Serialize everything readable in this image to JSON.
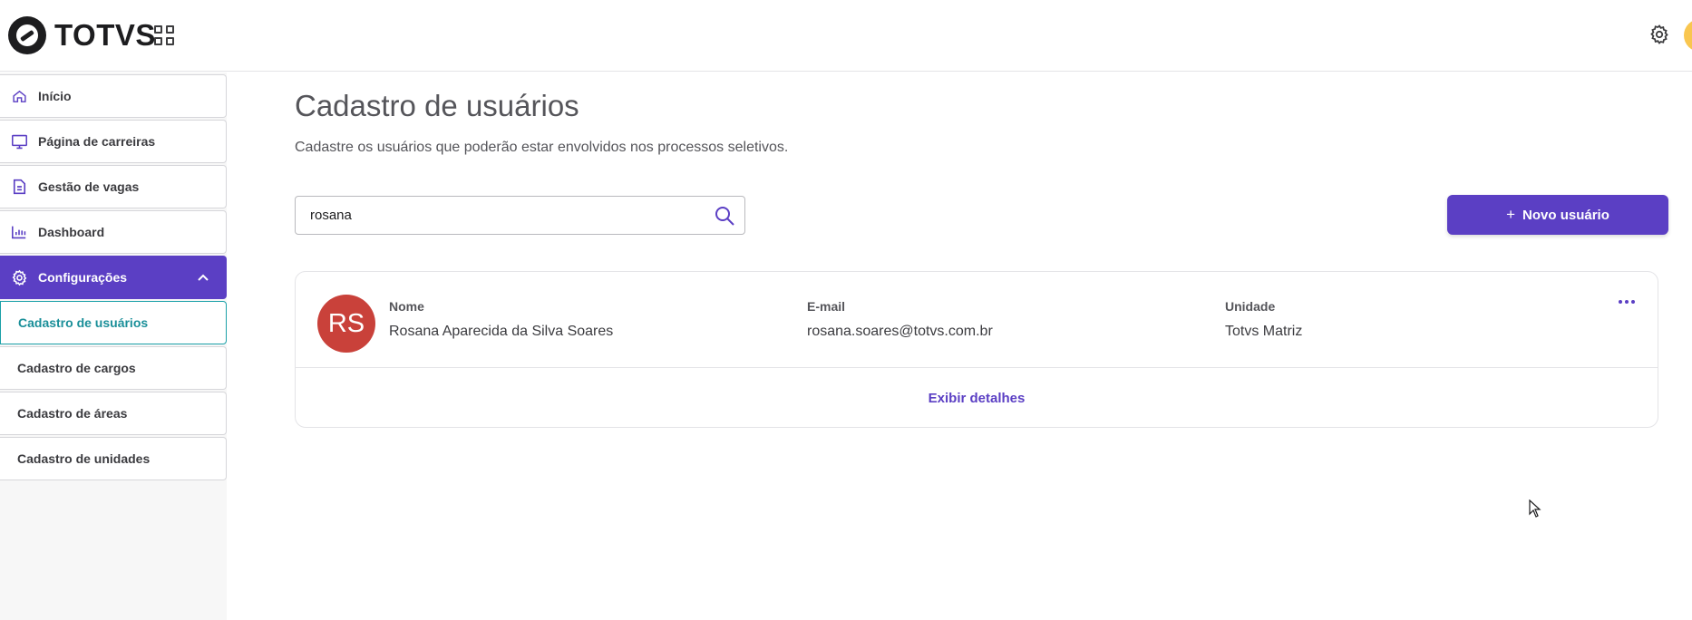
{
  "header": {
    "logo_text": "TOTVS",
    "apps_icon": "grid-icon",
    "settings_icon": "gear-icon",
    "avatar_color": "#f9c64f"
  },
  "sidebar": {
    "items": [
      {
        "label": "Início",
        "icon": "home-icon"
      },
      {
        "label": "Página de carreiras",
        "icon": "monitor-icon"
      },
      {
        "label": "Gestão de vagas",
        "icon": "document-icon"
      },
      {
        "label": "Dashboard",
        "icon": "bar-chart-icon"
      },
      {
        "label": "Configurações",
        "icon": "gear-icon",
        "active": true,
        "expanded": true
      }
    ],
    "sub_items": [
      {
        "label": "Cadastro de usuários",
        "selected": true
      },
      {
        "label": "Cadastro de cargos"
      },
      {
        "label": "Cadastro de áreas"
      },
      {
        "label": "Cadastro de unidades"
      }
    ]
  },
  "main": {
    "title": "Cadastro de usuários",
    "subtitle": "Cadastre os usuários que poderão estar envolvidos nos processos seletivos.",
    "search": {
      "value": "rosana",
      "icon": "search-icon"
    },
    "new_button": {
      "icon_text": "+",
      "label": "Novo usuário"
    },
    "user_card": {
      "initials": "RS",
      "avatar_color": "#c9413a",
      "name_label": "Nome",
      "name_value": "Rosana Aparecida da Silva Soares",
      "email_label": "E-mail",
      "email_value": "rosana.soares@totvs.com.br",
      "unit_label": "Unidade",
      "unit_value": "Totvs Matriz",
      "more_icon": "more-horizontal-icon",
      "details_link": "Exibir detalhes"
    }
  },
  "colors": {
    "primary": "#5b3fc4",
    "selected_sub_item": "#1aa0a8"
  }
}
